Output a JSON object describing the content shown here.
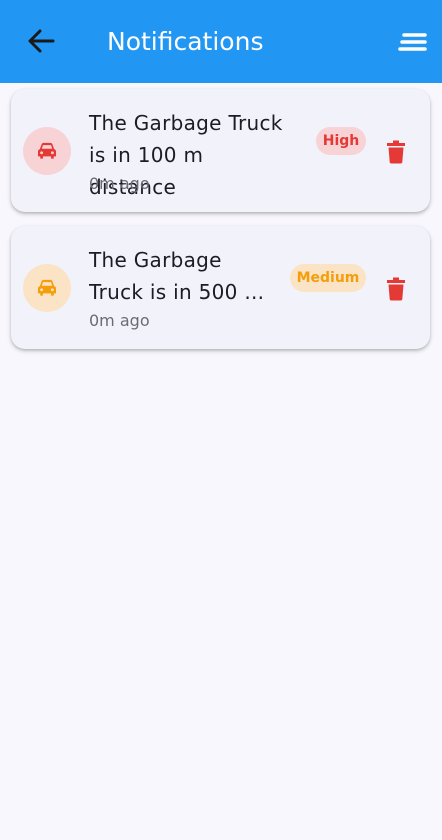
{
  "appbar": {
    "title": "Notifications",
    "back_icon": "arrow-back-icon",
    "sort_icon": "sort-icon",
    "color": "#2196f3"
  },
  "notifications": [
    {
      "message_line1": "The Garbage Truck",
      "message_line2": "is in 100 m distance",
      "time": "0m ago",
      "priority": "High",
      "icon": "car-icon",
      "accent": "#e53935"
    },
    {
      "message_line1": "The Garbage",
      "message_line2": "Truck is in 500 ...",
      "time": "0m ago",
      "priority": "Medium",
      "icon": "car-icon",
      "accent": "#f59e0b"
    }
  ],
  "delete_icon": "trash-icon"
}
